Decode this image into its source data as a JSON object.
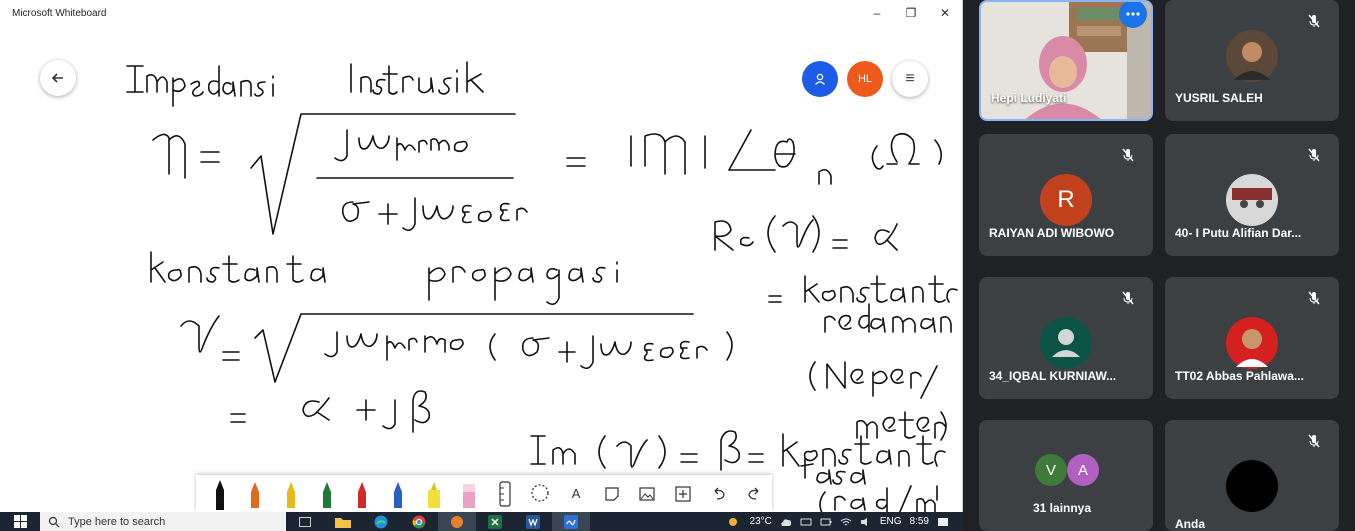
{
  "window": {
    "title": "Microsoft Whiteboard",
    "minimize": "–",
    "maximize": "❐",
    "close": "✕"
  },
  "whiteboard": {
    "user_initials": "HL",
    "menu_symbol": "≡"
  },
  "taskbar": {
    "search_placeholder": "Type here to search",
    "temperature": "23°C",
    "language": "ENG",
    "time": "8:59"
  },
  "meet": {
    "participants": [
      {
        "name": "Hepi Ludiyati",
        "mic_muted": false,
        "video": true
      },
      {
        "name": "YUSRIL SALEH",
        "mic_muted": true,
        "video": true
      },
      {
        "name": "RAIYAN ADI WIBOWO",
        "mic_muted": true,
        "avatar_letter": "R",
        "avatar_color": "#c1411c"
      },
      {
        "name": "40- I Putu Alifian Dar...",
        "mic_muted": true,
        "video": true
      },
      {
        "name": "34_IQBAL KURNIAW...",
        "mic_muted": true,
        "avatar_color": "#0b5346"
      },
      {
        "name": "TT02 Abbas Pahlawa...",
        "mic_muted": true,
        "video": true
      }
    ],
    "others": {
      "label": "31 lainnya",
      "avatars": [
        "V",
        "A"
      ],
      "colors": [
        "#3f7a3a",
        "#b060c0"
      ]
    },
    "self": {
      "name": "Anda"
    }
  },
  "colors": {
    "accent_blue": "#1d5de6",
    "accent_orange": "#ee5a1a",
    "meet_tile": "#3c4043",
    "meet_bg": "#202124"
  }
}
